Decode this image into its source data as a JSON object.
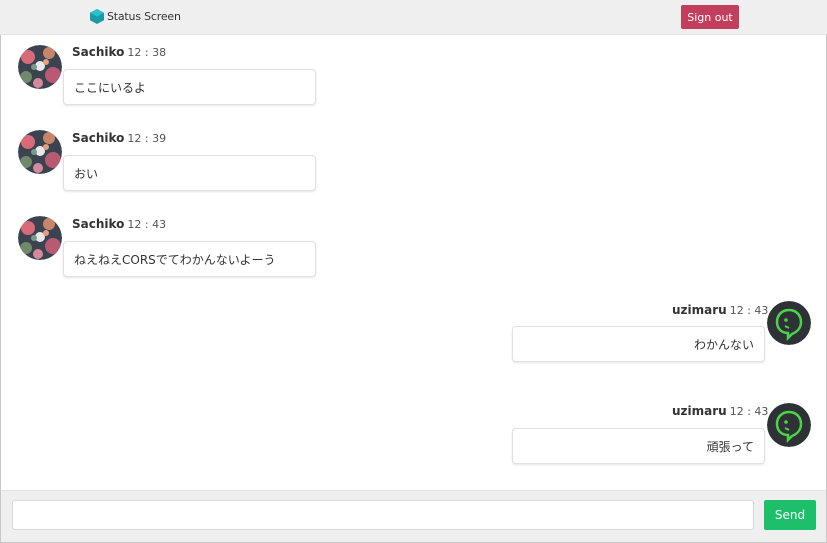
{
  "header": {
    "title": "Status Screen",
    "logo_icon": "hexagon-logo-icon",
    "logo_color": "#1a9aa8",
    "signout_label": "Sign out",
    "signout_color": "#c33d5c"
  },
  "messages": [
    {
      "user": "Sachiko",
      "time": "12 : 38",
      "text": "ここにいるよ",
      "side": "left",
      "avatar": "floral-avatar"
    },
    {
      "user": "Sachiko",
      "time": "12 : 39",
      "text": "おい",
      "side": "left",
      "avatar": "floral-avatar"
    },
    {
      "user": "Sachiko",
      "time": "12 : 43",
      "text": "ねえねえCORSでてわかんないよーう",
      "side": "left",
      "avatar": "floral-avatar"
    },
    {
      "user": "uzimaru",
      "time": "12 : 43",
      "text": "わかんない",
      "side": "right",
      "avatar": "green-ghost-avatar"
    },
    {
      "user": "uzimaru",
      "time": "12 : 43",
      "text": "頑張って",
      "side": "right",
      "avatar": "green-ghost-avatar"
    }
  ],
  "composer": {
    "placeholder": "",
    "value": "",
    "send_label": "Send",
    "send_color": "#1dbf6b"
  }
}
